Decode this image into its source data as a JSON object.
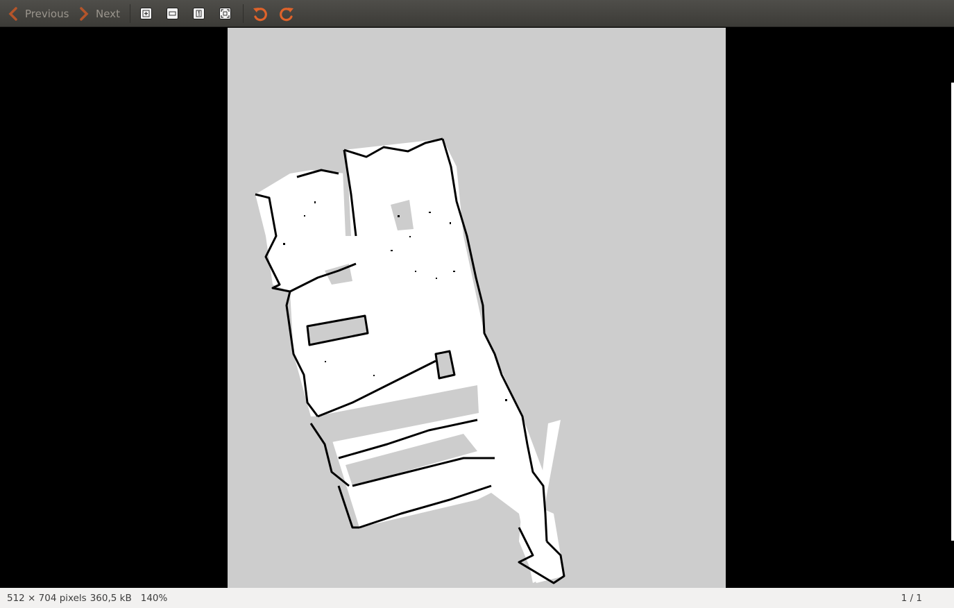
{
  "toolbar": {
    "previous_label": "Previous",
    "next_label": "Next",
    "icons": [
      "zoom-in-icon",
      "zoom-out-icon",
      "normal-size-icon",
      "best-fit-icon",
      "rotate-left-icon",
      "rotate-right-icon"
    ]
  },
  "viewer": {
    "image_content": "occupancy-grid-map",
    "colors": {
      "background": "#000000",
      "unknown": "#cdcdcd",
      "free": "#ffffff",
      "occupied": "#000000",
      "accent": "#e0632a"
    }
  },
  "status": {
    "dimensions": "512 × 704 pixels",
    "size": "360,5 kB",
    "zoom": "140%",
    "page": "1 / 1"
  }
}
